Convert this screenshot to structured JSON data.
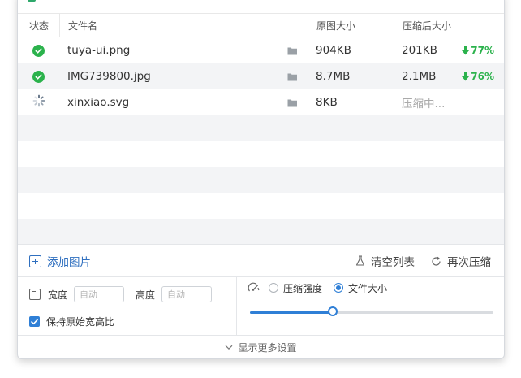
{
  "table": {
    "headers": {
      "status": "状态",
      "name": "文件名",
      "original": "原图大小",
      "compressed": "压缩后大小"
    },
    "rows": [
      {
        "status": "done",
        "name": "tuya-ui.png",
        "original": "904KB",
        "compressed": "201KB",
        "saving": "77%"
      },
      {
        "status": "done",
        "name": "IMG739800.jpg",
        "original": "8.7MB",
        "compressed": "2.1MB",
        "saving": "76%"
      },
      {
        "status": "processing",
        "name": "xinxiao.svg",
        "original": "8KB",
        "compressed": "压缩中...",
        "saving": ""
      }
    ]
  },
  "actions": {
    "add_images": "添加图片",
    "clear_list": "清空列表",
    "recompress": "再次压缩"
  },
  "settings": {
    "width_label": "宽度",
    "width_placeholder": "自动",
    "height_label": "高度",
    "height_placeholder": "自动",
    "keep_ratio_label": "保持原始宽高比",
    "keep_ratio_checked": true,
    "mode_strength_label": "压缩强度",
    "mode_size_label": "文件大小",
    "selected_mode": "文件大小",
    "slider_value": 0.34
  },
  "footer": {
    "more_settings": "显示更多设置"
  },
  "colors": {
    "accent": "#2f7fd6",
    "success": "#2bb24c",
    "link": "#2f6fbf"
  }
}
